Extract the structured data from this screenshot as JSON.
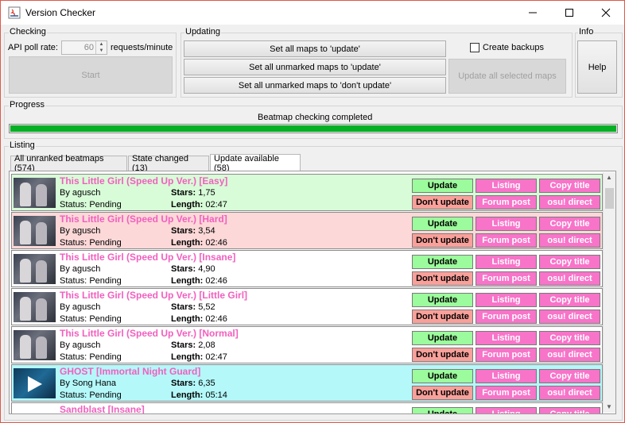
{
  "window": {
    "title": "Version Checker"
  },
  "checking": {
    "legend": "Checking",
    "poll_label": "API poll rate:",
    "poll_value": "60",
    "poll_unit": "requests/minute",
    "start_label": "Start"
  },
  "updating": {
    "legend": "Updating",
    "set_all": "Set all maps to 'update'",
    "set_unmarked_update": "Set all unmarked maps to 'update'",
    "set_unmarked_dont": "Set all unmarked maps to 'don't update'",
    "create_backups": "Create backups",
    "update_selected": "Update all selected maps"
  },
  "info": {
    "legend": "Info",
    "help": "Help"
  },
  "progress": {
    "legend": "Progress",
    "status": "Beatmap checking completed",
    "percent": 100
  },
  "listing": {
    "legend": "Listing",
    "tabs": [
      "All unranked beatmaps (574)",
      "State changed (13)",
      "Update available (58)"
    ],
    "active_tab": 2
  },
  "row_buttons": {
    "update": "Update",
    "dont_update": "Don't update",
    "listing": "Listing",
    "forum": "Forum post",
    "copy": "Copy title",
    "osu": "osu! direct"
  },
  "labels": {
    "by": "By",
    "status": "Status:",
    "stars": "Stars:",
    "length": "Length:"
  },
  "rows": [
    {
      "title": "This Little Girl (Speed Up Ver.) [Easy]",
      "author": "agusch",
      "status": "Pending",
      "stars": "1,75",
      "length": "02:47",
      "bg": "#d8fcd8",
      "thumb": "anime"
    },
    {
      "title": "This Little Girl (Speed Up Ver.) [Hard]",
      "author": "agusch",
      "status": "Pending",
      "stars": "3,54",
      "length": "02:46",
      "bg": "#fcd8d8",
      "thumb": "anime"
    },
    {
      "title": "This Little Girl (Speed Up Ver.) [Insane]",
      "author": "agusch",
      "status": "Pending",
      "stars": "4,90",
      "length": "02:46",
      "bg": "#ffffff",
      "thumb": "anime"
    },
    {
      "title": "This Little Girl (Speed Up Ver.) [Little Girl]",
      "author": "agusch",
      "status": "Pending",
      "stars": "5,52",
      "length": "02:46",
      "bg": "#ffffff",
      "thumb": "anime"
    },
    {
      "title": "This Little Girl (Speed Up Ver.) [Normal]",
      "author": "agusch",
      "status": "Pending",
      "stars": "2,08",
      "length": "02:47",
      "bg": "#ffffff",
      "thumb": "anime"
    },
    {
      "title": "GHOST [Immortal Night Guard]",
      "author": "Song Hana",
      "status": "Pending",
      "stars": "6,35",
      "length": "05:14",
      "bg": "#b4f8fa",
      "thumb": "ghost"
    },
    {
      "title": "Sandblast [Insane]",
      "author": "",
      "status": "",
      "stars": "",
      "length": "",
      "bg": "#ffffff",
      "thumb": "none"
    }
  ]
}
